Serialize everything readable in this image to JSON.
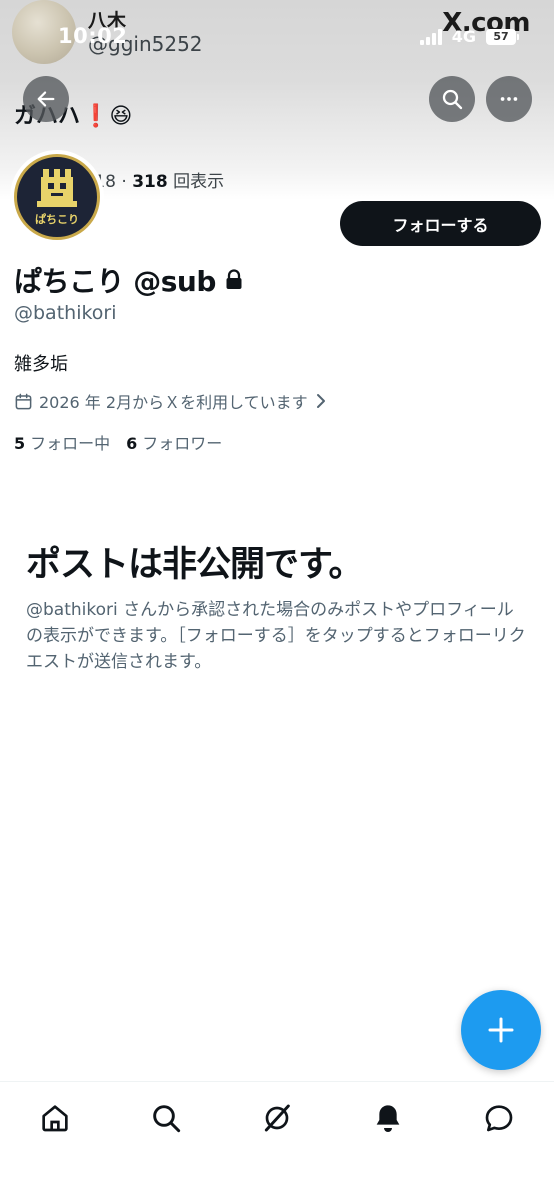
{
  "status_bar": {
    "time": "10:02",
    "network": "4G",
    "battery": "57"
  },
  "underlay": {
    "name": "八木",
    "handle": "@ggin5252",
    "site": "X.com",
    "post_text": "ガハハ",
    "post_emoji": "❗😆",
    "meta_date": "2026/04/18 · ",
    "meta_views": "318",
    "meta_views_label": " 回表示"
  },
  "profile": {
    "avatar_text": "ぱちこり",
    "display_name": "ぱちこり @sub",
    "handle": "@bathikori",
    "bio": "雑多垢",
    "joined": "2026 年 2月からＸを利用しています",
    "following_count": "5",
    "following_label": "フォロー中",
    "followers_count": "6",
    "followers_label": "フォロワー",
    "follow_button": "フォローする"
  },
  "private_notice": {
    "title": "ポストは非公開です。",
    "body": "@bathikori さんから承認された場合のみポストやプロフィールの表示ができます。［フォローする］をタップするとフォローリクエストが送信されます。"
  },
  "icons": {
    "back": "arrow-left",
    "search": "search",
    "more": "more-horizontal",
    "lock": "lock",
    "calendar": "calendar",
    "chevron": "chevron-right",
    "compose": "plus",
    "nav": [
      "home",
      "search",
      "grok",
      "notifications",
      "messages"
    ]
  },
  "colors": {
    "accent": "#1d9bf0",
    "text": "#0f1419",
    "secondary": "#536471"
  }
}
